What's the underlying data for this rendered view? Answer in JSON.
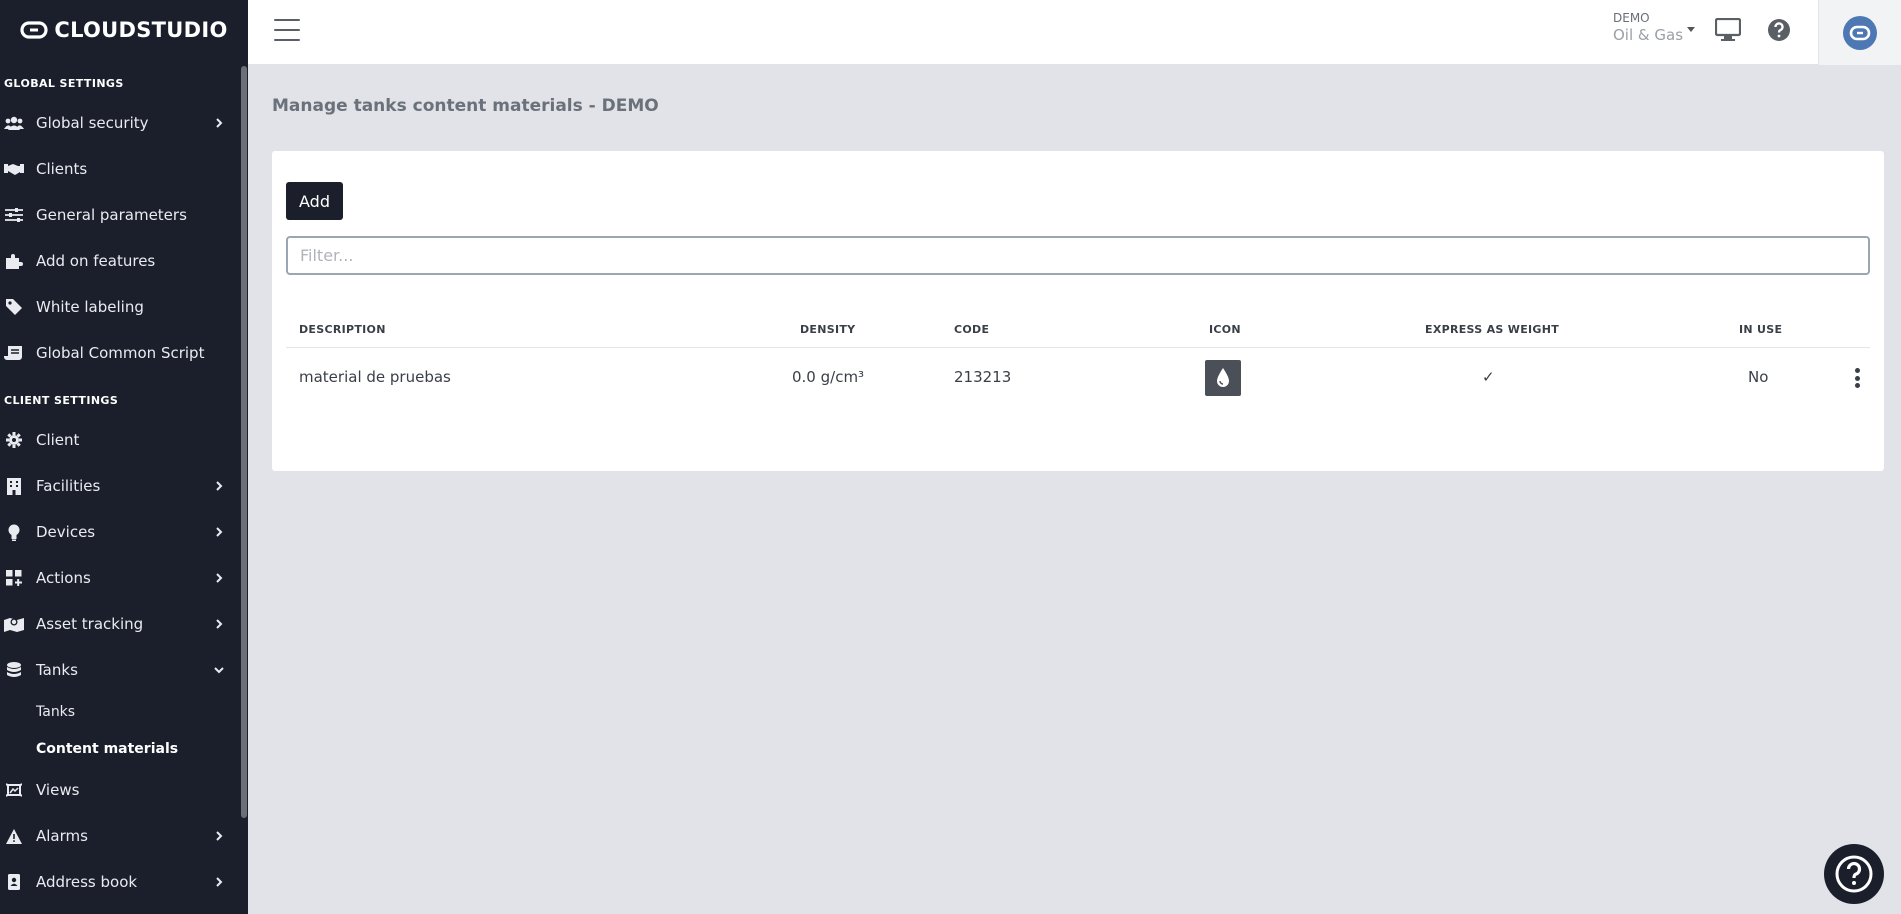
{
  "brand": {
    "name": "CLOUDSTUDIO"
  },
  "sidebar": {
    "global_section": "GLOBAL SETTINGS",
    "global_items": [
      {
        "label": "Global security",
        "icon": "users-icon",
        "has_children": true
      },
      {
        "label": "Clients",
        "icon": "handshake-icon",
        "has_children": false
      },
      {
        "label": "General parameters",
        "icon": "sliders-icon",
        "has_children": false
      },
      {
        "label": "Add on features",
        "icon": "puzzle-icon",
        "has_children": false
      },
      {
        "label": "White labeling",
        "icon": "tag-icon",
        "has_children": false
      },
      {
        "label": "Global Common Script",
        "icon": "scroll-icon",
        "has_children": false
      }
    ],
    "client_section": "CLIENT SETTINGS",
    "client_items": [
      {
        "label": "Client",
        "icon": "gear-icon",
        "has_children": false
      },
      {
        "label": "Facilities",
        "icon": "building-icon",
        "has_children": true
      },
      {
        "label": "Devices",
        "icon": "lightbulb-icon",
        "has_children": true
      },
      {
        "label": "Actions",
        "icon": "grid-plus-icon",
        "has_children": true
      },
      {
        "label": "Asset tracking",
        "icon": "map-marker-icon",
        "has_children": true
      },
      {
        "label": "Tanks",
        "icon": "database-icon",
        "has_children": true,
        "expanded": true
      },
      {
        "label": "Tanks",
        "sub": true
      },
      {
        "label": "Content materials",
        "sub": true,
        "active": true
      },
      {
        "label": "Views",
        "icon": "frame-icon",
        "has_children": false
      },
      {
        "label": "Alarms",
        "icon": "warning-icon",
        "has_children": true
      },
      {
        "label": "Address book",
        "icon": "address-book-icon",
        "has_children": true
      }
    ]
  },
  "topbar": {
    "client_line1": "DEMO",
    "client_line2": "Oil & Gas"
  },
  "main": {
    "title": "Manage tanks content materials - DEMO",
    "add_label": "Add",
    "filter_placeholder": "Filter...",
    "columns": [
      "DESCRIPTION",
      "DENSITY",
      "CODE",
      "ICON",
      "EXPRESS AS WEIGHT",
      "IN USE"
    ],
    "rows": [
      {
        "description": "material de pruebas",
        "density": "0.0 g/cm³",
        "code": "213213",
        "icon": "water-drop-icon",
        "express_as_weight": "✓",
        "in_use": "No"
      }
    ]
  },
  "colors": {
    "sidebar_bg": "#1b1f2b",
    "page_bg": "#e1e3e8",
    "accent": "#4d78b4"
  }
}
